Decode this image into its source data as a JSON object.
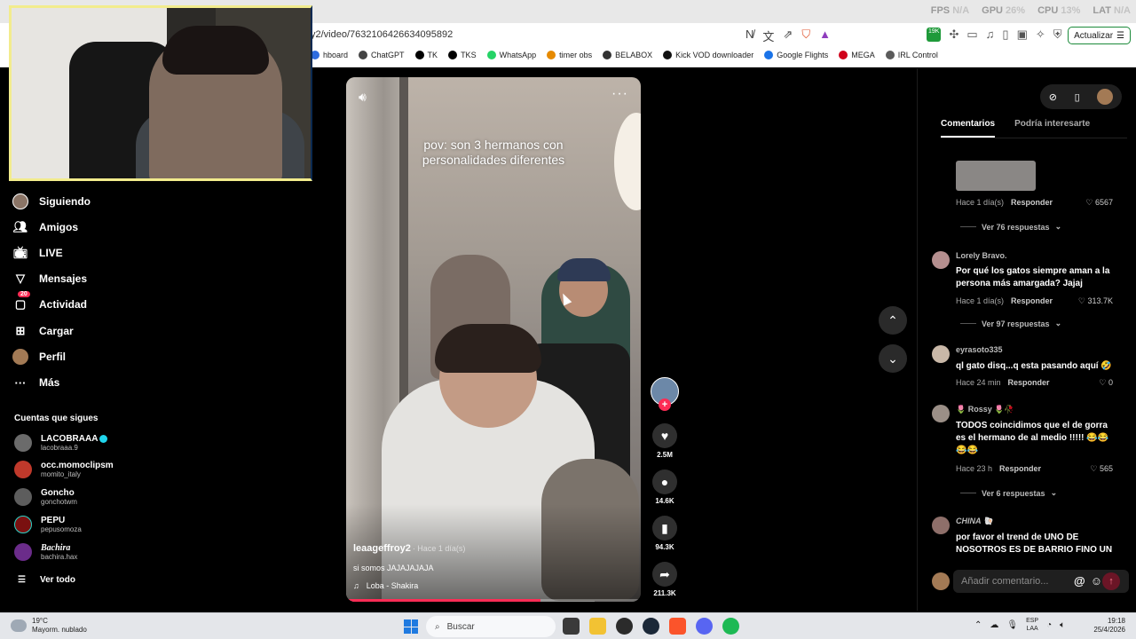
{
  "browser": {
    "perf": [
      {
        "label": "FPS",
        "value": "N/A"
      },
      {
        "label": "GPU",
        "value": "26%"
      },
      {
        "label": "CPU",
        "value": "13%"
      },
      {
        "label": "LAT",
        "value": "N/A"
      }
    ],
    "url": "y2/video/7632106426634095892",
    "update_label": "Actualizar",
    "extension_badge": "19K",
    "bookmarks": [
      "hboard",
      "ChatGPT",
      "TK",
      "TKS",
      "WhatsApp",
      "timer obs",
      "BELABOX",
      "Kick VOD downloader",
      "Google Flights",
      "MEGA",
      "IRL Control"
    ]
  },
  "sidebar": {
    "nav": [
      {
        "label": "Siguiendo",
        "icon": "following-avatar-icon"
      },
      {
        "label": "Amigos",
        "icon": "friends-icon"
      },
      {
        "label": "LIVE",
        "icon": "live-icon"
      },
      {
        "label": "Mensajes",
        "icon": "messages-icon"
      },
      {
        "label": "Actividad",
        "icon": "activity-icon",
        "badge": "20"
      },
      {
        "label": "Cargar",
        "icon": "upload-icon"
      },
      {
        "label": "Perfil",
        "icon": "profile-avatar-icon"
      },
      {
        "label": "Más",
        "icon": "more-icon"
      }
    ],
    "following_title": "Cuentas que sigues",
    "following": [
      {
        "name": "LACOBRAAA",
        "handle": "lacobraaa.9",
        "verified": true
      },
      {
        "name": "occ.momoclipsm",
        "handle": "momito_italy"
      },
      {
        "name": "Goncho",
        "handle": "gonchotwm"
      },
      {
        "name": "PEPU",
        "handle": "pepusomoza"
      },
      {
        "name": "Bachira",
        "handle": "bachira.hax"
      }
    ],
    "see_all": "Ver todo"
  },
  "video": {
    "caption_line1": "pov: son 3 hermanos con",
    "caption_line2": "personalidades diferentes",
    "author": "leaageffroy2",
    "date": "· Hace 1 día(s)",
    "description": "si somos JAJAJAJAJA",
    "music": "Loba - Shakira",
    "progress": 0.66
  },
  "actions": {
    "likes": "2.5M",
    "comments": "14.6K",
    "saves": "94.3K",
    "shares": "211.3K"
  },
  "comments": {
    "tabs": [
      "Comentarios",
      "Podría interesarte"
    ],
    "items": [
      {
        "user": "",
        "text": "",
        "time": "Hace 1 día(s)",
        "reply": "Responder",
        "likes": "6567",
        "more": "Ver 76 respuestas"
      },
      {
        "user": "Lorely Bravo.",
        "text": "Por qué los gatos siempre aman a la persona más amargada? Jajaj",
        "time": "Hace 1 día(s)",
        "reply": "Responder",
        "likes": "313.7K",
        "more": "Ver 97 respuestas"
      },
      {
        "user": "eyrasoto335",
        "text": "ql gato disq...q esta pasando aquí 🤣",
        "time": "Hace 24 min",
        "reply": "Responder",
        "likes": "0",
        "more": ""
      },
      {
        "user": "🌷 Rossy 🌷🥀",
        "text": "TODOS coincidimos que el de gorra es el hermano de al medio !!!!! 😂😂😂😂",
        "time": "Hace 23 h",
        "reply": "Responder",
        "likes": "565",
        "more": "Ver 6 respuestas"
      },
      {
        "user": "CHINA 🐚",
        "text": "por favor el trend de UNO DE NOSOTROS ES DE BARRIO FINO UN",
        "time": "",
        "reply": "",
        "likes": "",
        "more": ""
      }
    ],
    "input_placeholder": "Añadir comentario..."
  },
  "taskbar": {
    "temp": "19°C",
    "weather": "Mayorm. nublado",
    "search": "Buscar",
    "lang1": "ESP",
    "lang2": "LAA",
    "time": "19:18",
    "date": "25/4/2026"
  },
  "colors": {
    "accent": "#fe2c55",
    "webcam_border": "#f2ec8d",
    "update_border": "#1b8a3a"
  }
}
